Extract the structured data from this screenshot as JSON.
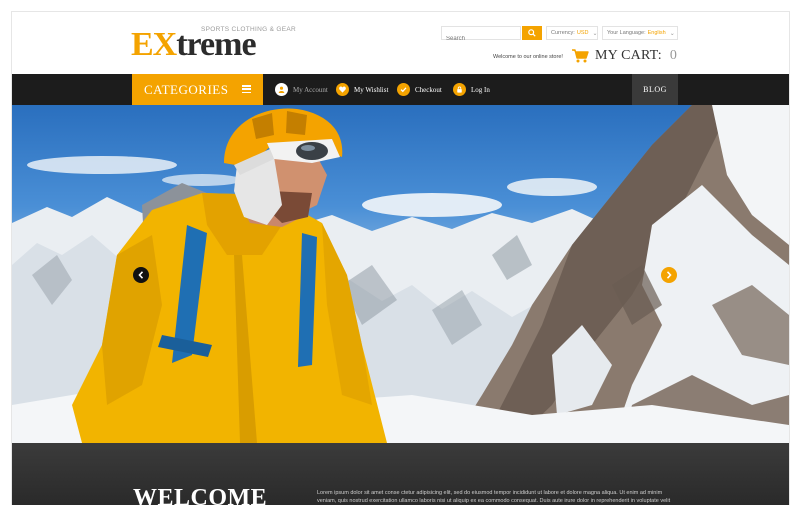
{
  "brand": {
    "prefix": "EX",
    "rest": "treme",
    "tagline": "SPORTS CLOTHING & GEAR",
    "accent_color": "#f4a300"
  },
  "header": {
    "search_placeholder": "Search",
    "currency_label": "Currency:",
    "currency_value": "USD",
    "language_label": "Your Language:",
    "language_value": "English",
    "welcome": "Welcome to our online store!",
    "cart_label": "MY CART:",
    "cart_count": "0"
  },
  "nav": {
    "categories": "CATEGORIES",
    "links": [
      {
        "label": "My Account",
        "icon": "user-icon"
      },
      {
        "label": "My Wishlist",
        "icon": "heart-icon"
      },
      {
        "label": "Checkout",
        "icon": "check-icon"
      },
      {
        "label": "Log In",
        "icon": "lock-icon"
      }
    ],
    "blog": "BLOG"
  },
  "hero": {
    "prev_icon": "chevron-left-icon",
    "next_icon": "chevron-right-icon"
  },
  "welcome_section": {
    "title": "WELCOME",
    "text": "Lorem ipsum dolor sit amet conse ctetur adipisicing elit, sed do eiusmod tempor incididunt ut labore et dolore magna aliqua. Ut enim ad minim veniam, quis nostrud exercitation ullamco laboris nisi ut aliquip ex ea commodo consequat. Duis aute irure dolor in reprehenderit in voluptate velit esse."
  }
}
